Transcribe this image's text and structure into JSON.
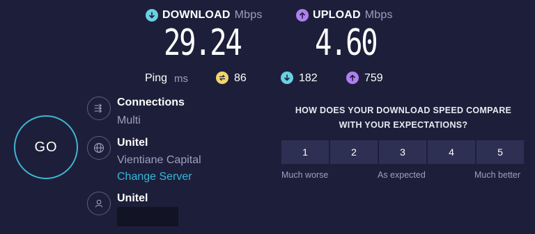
{
  "download": {
    "label": "DOWNLOAD",
    "unit": "Mbps",
    "value": "29.24",
    "icon": "download-arrow-icon"
  },
  "upload": {
    "label": "UPLOAD",
    "unit": "Mbps",
    "value": "4.60",
    "icon": "upload-arrow-icon"
  },
  "ping": {
    "label": "Ping",
    "unit": "ms",
    "idle": "86",
    "download": "182",
    "upload": "759"
  },
  "go_button": {
    "label": "GO"
  },
  "connections": {
    "title": "Connections",
    "value": "Multi",
    "icon": "connections-icon"
  },
  "server": {
    "title": "Unitel",
    "location": "Vientiane Capital",
    "change_link": "Change Server",
    "icon": "globe-icon"
  },
  "provider": {
    "title": "Unitel",
    "icon": "user-icon"
  },
  "survey": {
    "question_line1": "HOW DOES YOUR DOWNLOAD SPEED COMPARE",
    "question_line2": "WITH YOUR EXPECTATIONS?",
    "options": [
      "1",
      "2",
      "3",
      "4",
      "5"
    ],
    "label_low": "Much worse",
    "label_mid": "As expected",
    "label_high": "Much better"
  },
  "colors": {
    "background": "#1d1f3a",
    "download_accent": "#6ad1e2",
    "upload_accent": "#b07ef0",
    "ping_accent": "#f2d66b",
    "link": "#33b9dd"
  }
}
